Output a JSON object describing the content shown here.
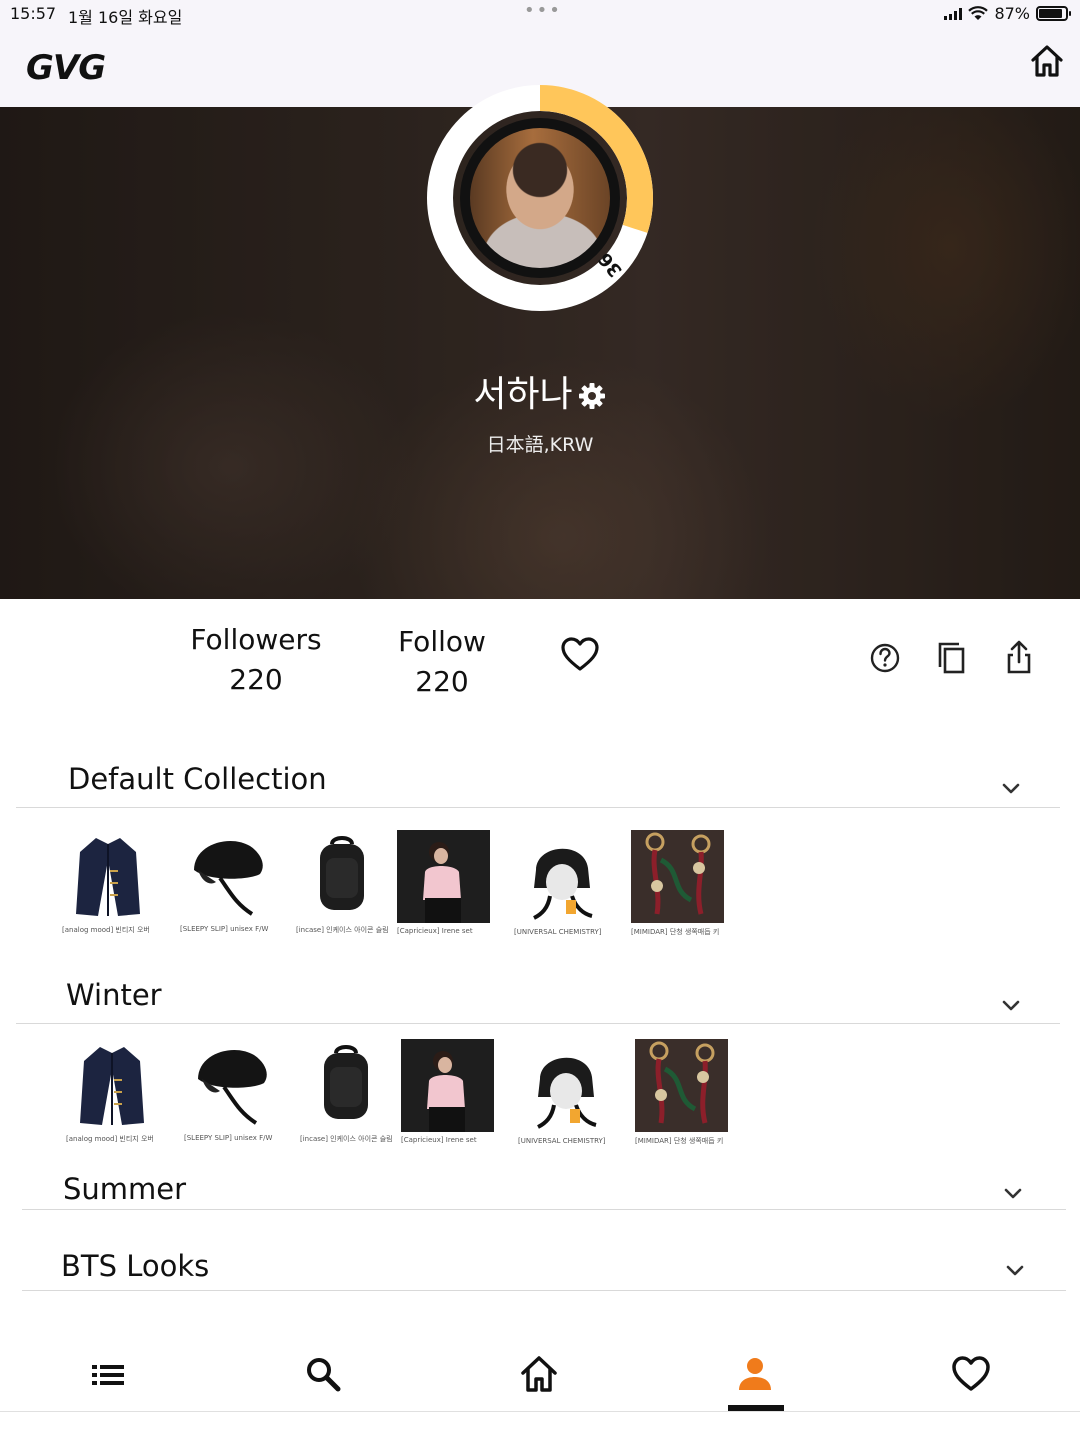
{
  "status_bar": {
    "time": "15:57",
    "date": "1월 16일 화요일",
    "battery": "87%",
    "battery_level": 0.87
  },
  "app": {
    "logo": "GVG",
    "header_icon": "home-icon"
  },
  "profile": {
    "name": "서하나",
    "meta": "日本語,KRW",
    "level": "36",
    "level_progress": 0.3,
    "accent_color": "#ffc65a",
    "settings_icon": "gear-icon"
  },
  "stats": {
    "followers_label": "Followers",
    "followers_value": "220",
    "follow_label": "Follow",
    "follow_value": "220"
  },
  "actions": {
    "like_icon": "heart-outline-icon",
    "help_icon": "help-circle-icon",
    "copy_icon": "copy-icon",
    "share_icon": "share-icon"
  },
  "collections": [
    {
      "title": "Default Collection",
      "expanded": true,
      "items": [
        {
          "caption": "[analog mood] 빈티지 오버"
        },
        {
          "caption": "[SLEEPY SLIP] unisex F/W"
        },
        {
          "caption": "[incase] 인케이스 아이콘 슬림"
        },
        {
          "caption": "[Capricieux] Irene set"
        },
        {
          "caption": "[UNIVERSAL CHEMISTRY]"
        },
        {
          "caption": "[MIMIDAR] 단청 생쪽매듭 키"
        }
      ]
    },
    {
      "title": "Winter",
      "expanded": true,
      "items": [
        {
          "caption": "[analog mood] 빈티지 오버"
        },
        {
          "caption": "[SLEEPY SLIP] unisex F/W"
        },
        {
          "caption": "[incase] 인케이스 아이콘 슬림"
        },
        {
          "caption": "[Capricieux] Irene set"
        },
        {
          "caption": "[UNIVERSAL CHEMISTRY]"
        },
        {
          "caption": "[MIMIDAR] 단청 생쪽매듭 키"
        }
      ]
    },
    {
      "title": "Summer",
      "expanded": false,
      "items": []
    },
    {
      "title": "BTS Looks",
      "expanded": false,
      "items": []
    }
  ],
  "bottom_nav": {
    "items": [
      {
        "icon": "menu-icon"
      },
      {
        "icon": "search-icon"
      },
      {
        "icon": "home-icon"
      },
      {
        "icon": "profile-icon",
        "active": true,
        "color": "#f07b1b"
      },
      {
        "icon": "heart-icon"
      }
    ]
  }
}
